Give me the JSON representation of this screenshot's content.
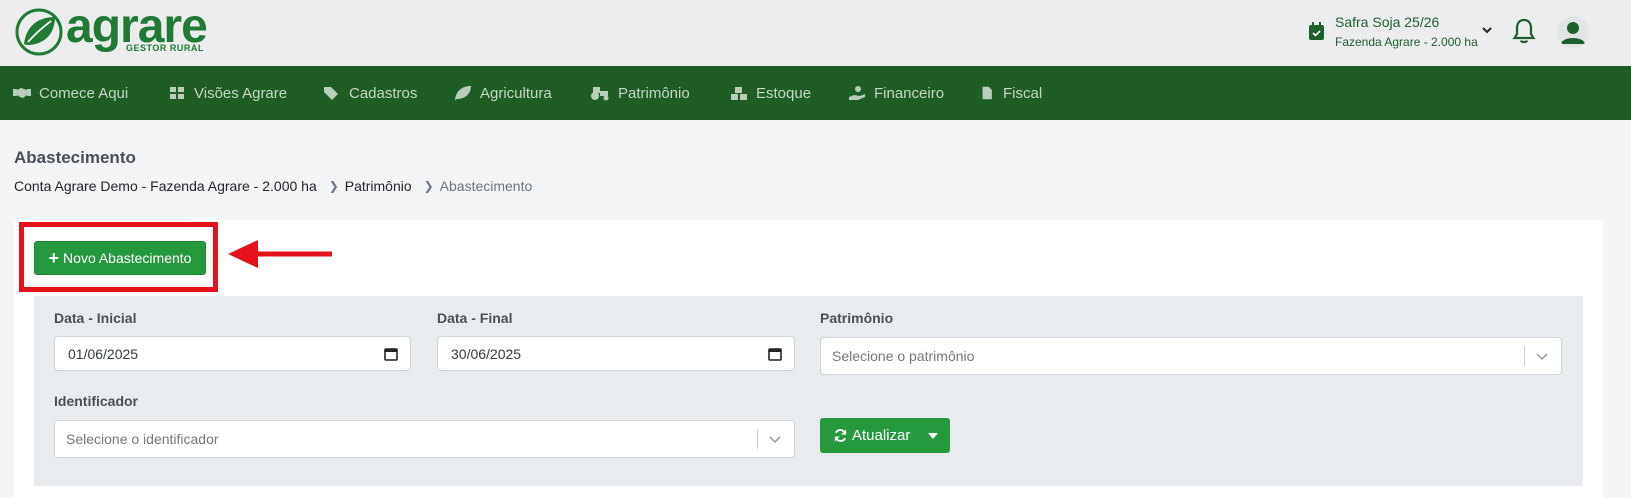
{
  "brand": {
    "name": "agrare",
    "tagline": "GESTOR RURAL",
    "color": "#1f7a35"
  },
  "header": {
    "season_title": "Safra Soja 25/26",
    "season_farm": "Fazenda Agrare - 2.000 ha"
  },
  "nav": {
    "items": [
      {
        "label": "Comece Aqui",
        "icon": "handshake-icon"
      },
      {
        "label": "Visões Agrare",
        "icon": "dashboard-icon"
      },
      {
        "label": "Cadastros",
        "icon": "tags-icon"
      },
      {
        "label": "Agricultura",
        "icon": "leaf-icon"
      },
      {
        "label": "Patrimônio",
        "icon": "tractor-icon"
      },
      {
        "label": "Estoque",
        "icon": "boxes-icon"
      },
      {
        "label": "Financeiro",
        "icon": "hand-coin-icon"
      },
      {
        "label": "Fiscal",
        "icon": "invoice-icon"
      }
    ],
    "background": "#1e5d25"
  },
  "page": {
    "title": "Abastecimento",
    "breadcrumb": [
      "Conta Agrare Demo - Fazenda Agrare - 2.000 ha",
      "Patrimônio",
      "Abastecimento"
    ]
  },
  "actions": {
    "new_label": "Novo Abastecimento"
  },
  "filters": {
    "date_start_label": "Data - Inicial",
    "date_start_value": "01/06/2025",
    "date_end_label": "Data - Final",
    "date_end_value": "30/06/2025",
    "asset_label": "Patrimônio",
    "asset_placeholder": "Selecione o patrimônio",
    "identifier_label": "Identificador",
    "identifier_placeholder": "Selecione o identificador",
    "refresh_label": "Atualizar"
  },
  "colors": {
    "primary_button": "#259a3d",
    "annotation_red": "#e5121b"
  }
}
